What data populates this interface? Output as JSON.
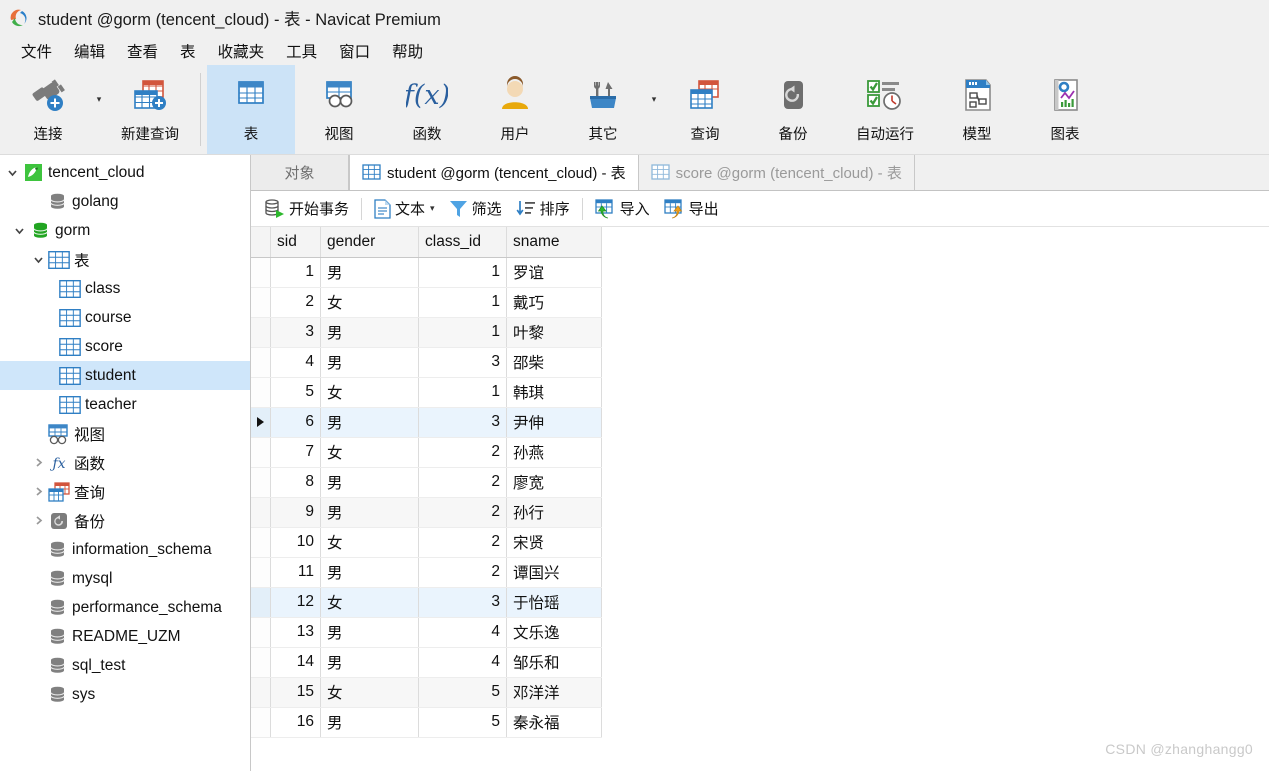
{
  "window": {
    "title": "student @gorm (tencent_cloud) - 表 - Navicat Premium",
    "logo_icon": "navicat-logo-icon"
  },
  "menubar": {
    "items": [
      {
        "label": "文件",
        "name": "menu-file"
      },
      {
        "label": "编辑",
        "name": "menu-edit"
      },
      {
        "label": "查看",
        "name": "menu-view"
      },
      {
        "label": "表",
        "name": "menu-table"
      },
      {
        "label": "收藏夹",
        "name": "menu-favorites"
      },
      {
        "label": "工具",
        "name": "menu-tools"
      },
      {
        "label": "窗口",
        "name": "menu-window"
      },
      {
        "label": "帮助",
        "name": "menu-help"
      }
    ]
  },
  "toolbar": {
    "buttons": [
      {
        "label": "连接",
        "icon": "connection-plug-icon",
        "active": false,
        "caret": true
      },
      {
        "label": "新建查询",
        "icon": "new-query-icon",
        "active": false,
        "caret": false
      },
      {
        "label": "表",
        "icon": "table-icon",
        "active": true,
        "caret": false
      },
      {
        "label": "视图",
        "icon": "view-icon",
        "active": false,
        "caret": false
      },
      {
        "label": "函数",
        "icon": "function-fx-icon",
        "active": false,
        "caret": false
      },
      {
        "label": "用户",
        "icon": "user-icon",
        "active": false,
        "caret": false
      },
      {
        "label": "其它",
        "icon": "other-tools-icon",
        "active": false,
        "caret": true
      },
      {
        "label": "查询",
        "icon": "query-icon",
        "active": false,
        "caret": false
      },
      {
        "label": "备份",
        "icon": "backup-icon",
        "active": false,
        "caret": false
      },
      {
        "label": "自动运行",
        "icon": "automation-icon",
        "active": false,
        "caret": false
      },
      {
        "label": "模型",
        "icon": "model-icon",
        "active": false,
        "caret": false
      },
      {
        "label": "图表",
        "icon": "chart-icon",
        "active": false,
        "caret": false
      }
    ]
  },
  "sidebar": {
    "items": [
      {
        "label": "tencent_cloud",
        "icon": "connection-icon",
        "indent": 0,
        "arrow": "down",
        "selected": false
      },
      {
        "label": "golang",
        "icon": "database-gray-icon",
        "indent": 1,
        "arrow": "none",
        "selected": false
      },
      {
        "label": "gorm",
        "icon": "database-open-icon",
        "indent": 1,
        "arrow": "down",
        "selected": false
      },
      {
        "label": "表",
        "icon": "table-icon",
        "indent": 2,
        "arrow": "down",
        "selected": false
      },
      {
        "label": "class",
        "icon": "table-icon",
        "indent": 3,
        "arrow": "none",
        "selected": false
      },
      {
        "label": "course",
        "icon": "table-icon",
        "indent": 3,
        "arrow": "none",
        "selected": false
      },
      {
        "label": "score",
        "icon": "table-icon",
        "indent": 3,
        "arrow": "none",
        "selected": false
      },
      {
        "label": "student",
        "icon": "table-icon",
        "indent": 3,
        "arrow": "none",
        "selected": true
      },
      {
        "label": "teacher",
        "icon": "table-icon",
        "indent": 3,
        "arrow": "none",
        "selected": false
      },
      {
        "label": "视图",
        "icon": "view-icon",
        "indent": 2,
        "arrow": "none",
        "selected": false
      },
      {
        "label": "函数",
        "icon": "function-fx-icon",
        "indent": 2,
        "arrow": "right",
        "selected": false
      },
      {
        "label": "查询",
        "icon": "query-icon",
        "indent": 2,
        "arrow": "right",
        "selected": false
      },
      {
        "label": "备份",
        "icon": "backup-icon",
        "indent": 2,
        "arrow": "right",
        "selected": false
      },
      {
        "label": "information_schema",
        "icon": "database-gray-icon",
        "indent": 1,
        "arrow": "none",
        "selected": false
      },
      {
        "label": "mysql",
        "icon": "database-gray-icon",
        "indent": 1,
        "arrow": "none",
        "selected": false
      },
      {
        "label": "performance_schema",
        "icon": "database-gray-icon",
        "indent": 1,
        "arrow": "none",
        "selected": false
      },
      {
        "label": "README_UZM",
        "icon": "database-gray-icon",
        "indent": 1,
        "arrow": "none",
        "selected": false
      },
      {
        "label": "sql_test",
        "icon": "database-gray-icon",
        "indent": 1,
        "arrow": "none",
        "selected": false
      },
      {
        "label": "sys",
        "icon": "database-gray-icon",
        "indent": 1,
        "arrow": "none",
        "selected": false
      }
    ]
  },
  "tabs": [
    {
      "label": "对象",
      "icon": "none",
      "state": "object"
    },
    {
      "label": "student @gorm (tencent_cloud) - 表",
      "icon": "table-icon",
      "state": "active"
    },
    {
      "label": "score @gorm (tencent_cloud) - 表",
      "icon": "table-icon",
      "state": "inactive"
    }
  ],
  "grid_toolbar": {
    "buttons": [
      {
        "label": "开始事务",
        "icon": "begin-transaction-icon",
        "caret": false
      },
      {
        "label": "文本",
        "icon": "text-document-icon",
        "caret": true
      },
      {
        "label": "筛选",
        "icon": "filter-funnel-icon",
        "caret": false
      },
      {
        "label": "排序",
        "icon": "sort-icon",
        "caret": false
      },
      {
        "label": "导入",
        "icon": "import-icon",
        "caret": false
      },
      {
        "label": "导出",
        "icon": "export-icon",
        "caret": false
      }
    ]
  },
  "data_grid": {
    "columns": [
      "sid",
      "gender",
      "class_id",
      "sname"
    ],
    "selected_column": "sid",
    "selected_row_index": 5,
    "rows": [
      {
        "sid": "1",
        "gender": "男",
        "class_id": "1",
        "sname": "罗谊"
      },
      {
        "sid": "2",
        "gender": "女",
        "class_id": "1",
        "sname": "戴巧"
      },
      {
        "sid": "3",
        "gender": "男",
        "class_id": "1",
        "sname": "叶黎"
      },
      {
        "sid": "4",
        "gender": "男",
        "class_id": "3",
        "sname": "邵柴"
      },
      {
        "sid": "5",
        "gender": "女",
        "class_id": "1",
        "sname": "韩琪"
      },
      {
        "sid": "6",
        "gender": "男",
        "class_id": "3",
        "sname": "尹伸"
      },
      {
        "sid": "7",
        "gender": "女",
        "class_id": "2",
        "sname": "孙燕"
      },
      {
        "sid": "8",
        "gender": "男",
        "class_id": "2",
        "sname": "廖宽"
      },
      {
        "sid": "9",
        "gender": "男",
        "class_id": "2",
        "sname": "孙行"
      },
      {
        "sid": "10",
        "gender": "女",
        "class_id": "2",
        "sname": "宋贤"
      },
      {
        "sid": "11",
        "gender": "男",
        "class_id": "2",
        "sname": "谭国兴"
      },
      {
        "sid": "12",
        "gender": "女",
        "class_id": "3",
        "sname": "于怡瑶"
      },
      {
        "sid": "13",
        "gender": "男",
        "class_id": "4",
        "sname": "文乐逸"
      },
      {
        "sid": "14",
        "gender": "男",
        "class_id": "4",
        "sname": "邹乐和"
      },
      {
        "sid": "15",
        "gender": "女",
        "class_id": "5",
        "sname": "邓洋洋"
      },
      {
        "sid": "16",
        "gender": "男",
        "class_id": "5",
        "sname": "秦永福"
      }
    ]
  },
  "watermark": {
    "text": "CSDN @zhanghangg0"
  },
  "colors": {
    "accent_blue": "#3d85c6",
    "table_icon_blue": "#2e7cc4",
    "selection_blue": "#cfe6fa",
    "toolbar_bg": "#f0f0f0",
    "db_green": "#22a522",
    "db_gray": "#808080"
  }
}
